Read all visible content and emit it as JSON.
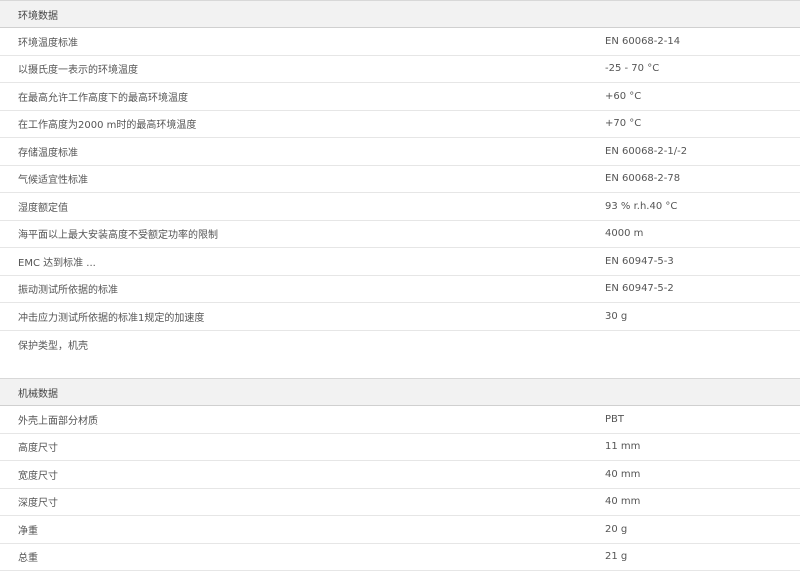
{
  "environmental": {
    "title": "环境数据",
    "rows": [
      {
        "label": "环境温度标准",
        "value": "EN 60068-2-14"
      },
      {
        "label": "以摄氏度一表示的环境温度",
        "value": "-25 - 70  °C"
      },
      {
        "label": "在最高允许工作高度下的最高环境温度",
        "value": "+60 °C"
      },
      {
        "label": "在工作高度为2000 m时的最高环境温度",
        "value": "+70 °C"
      },
      {
        "label": "存储温度标准",
        "value": "EN 60068-2-1/-2"
      },
      {
        "label": "气候适宜性标准",
        "value": "EN 60068-2-78"
      },
      {
        "label": "湿度额定值",
        "value": "93 % r.h.40 °C"
      },
      {
        "label": "海平面以上最大安装高度不受额定功率的限制",
        "value": "4000 m"
      },
      {
        "label": "EMC 达到标准 ...",
        "value": "EN 60947-5-3"
      },
      {
        "label": "振动测试所依据的标准",
        "value": "EN 60947-5-2"
      },
      {
        "label": "冲击应力测试所依据的标准1规定的加速度",
        "value": "30 g"
      },
      {
        "label": "保护类型，机壳",
        "value": ""
      }
    ]
  },
  "mechanical": {
    "title": "机械数据",
    "rows": [
      {
        "label": "外壳上面部分材质",
        "value": "PBT"
      },
      {
        "label": "高度尺寸",
        "value": "11  mm"
      },
      {
        "label": "宽度尺寸",
        "value": "40  mm"
      },
      {
        "label": "深度尺寸",
        "value": "40  mm"
      },
      {
        "label": "净重",
        "value": "20  g"
      },
      {
        "label": "总重",
        "value": "21  g"
      }
    ]
  }
}
